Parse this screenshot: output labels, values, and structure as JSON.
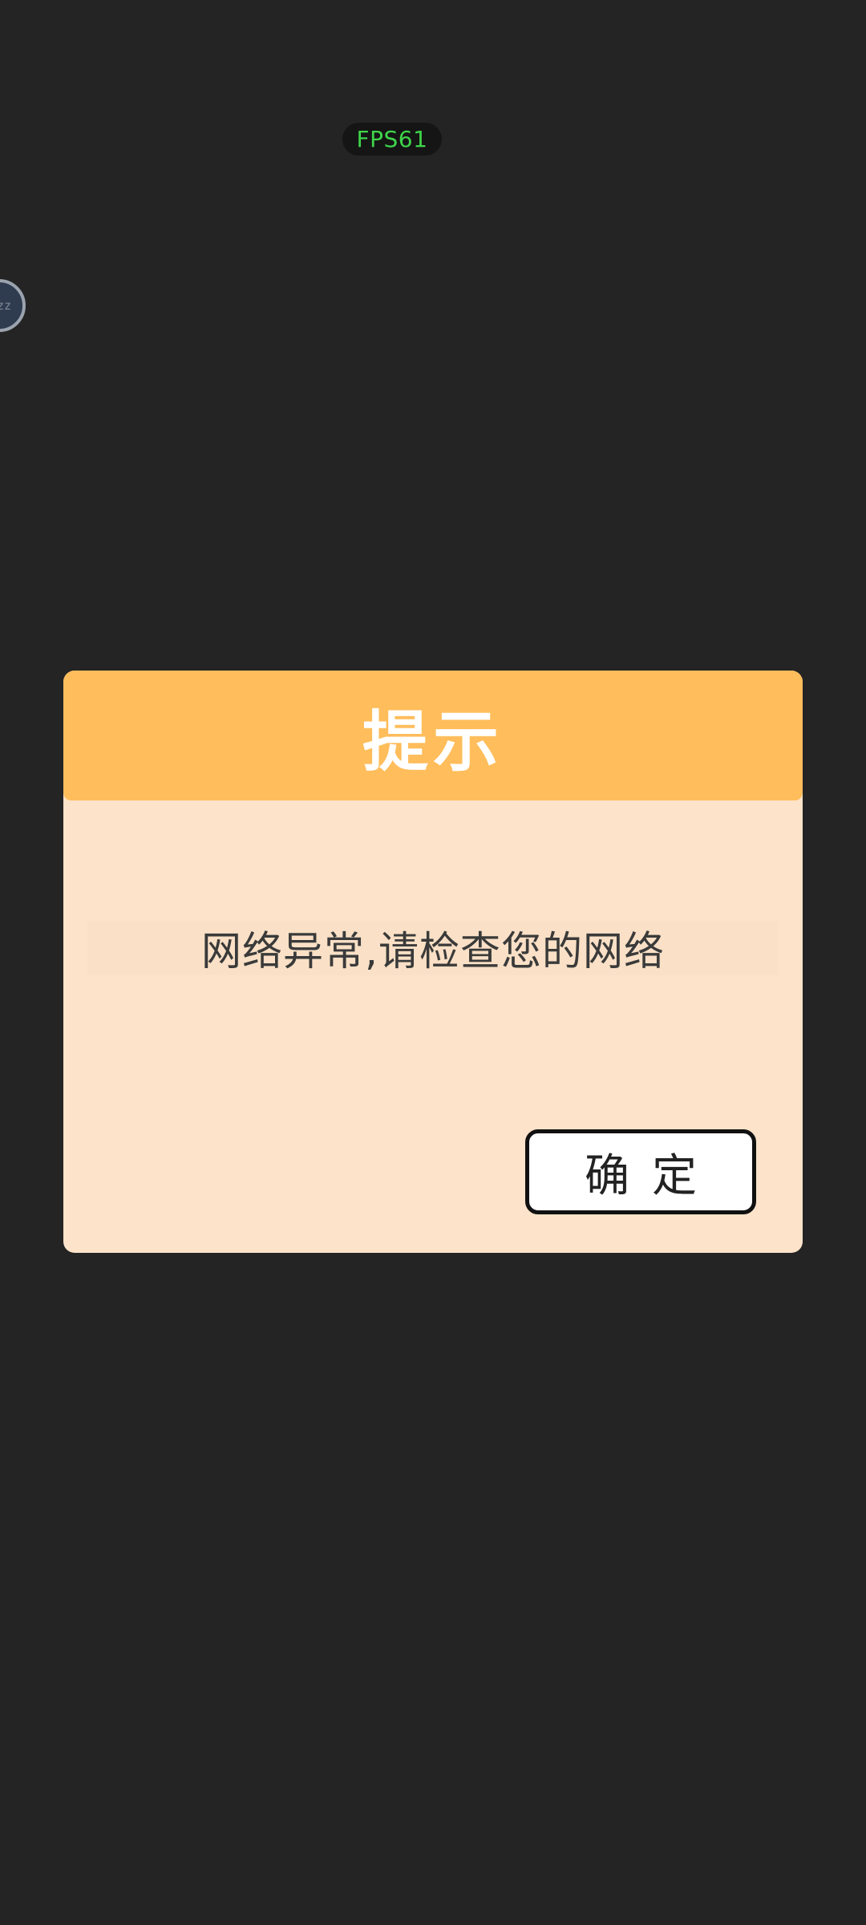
{
  "overlay": {
    "fps_label": "FPS61",
    "floating_ball_text": "zz"
  },
  "dialog": {
    "title": "提示",
    "message": "网络异常,请检查您的网络",
    "confirm_label": "确定"
  },
  "colors": {
    "background": "#242424",
    "dialog_body": "#fde3c9",
    "dialog_header": "#ffbd5b",
    "fps_text": "#3fd44a"
  }
}
